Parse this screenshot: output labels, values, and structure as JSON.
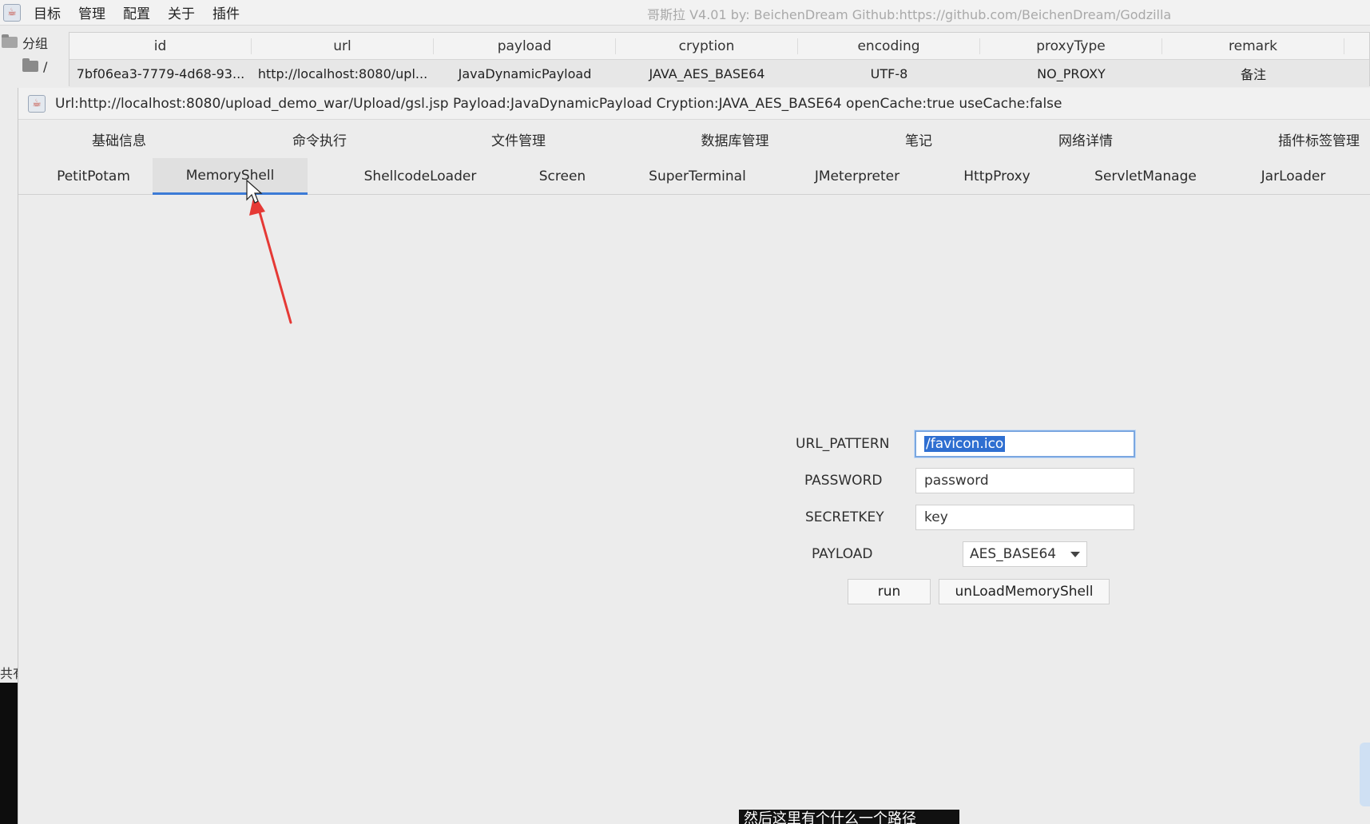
{
  "menubar": {
    "items": [
      "目标",
      "管理",
      "配置",
      "关于",
      "插件"
    ],
    "title": "哥斯拉   V4.01 by: BeichenDream Github:https://github.com/BeichenDream/Godzilla"
  },
  "tree": {
    "group_label": "分组",
    "root_label": "/"
  },
  "table": {
    "headers": [
      "id",
      "url",
      "payload",
      "cryption",
      "encoding",
      "proxyType",
      "remark"
    ],
    "row": [
      "7bf06ea3-7779-4d68-93...",
      "http://localhost:8080/upl...",
      "JavaDynamicPayload",
      "JAVA_AES_BASE64",
      "UTF-8",
      "NO_PROXY",
      "备注"
    ]
  },
  "shell": {
    "title": "Url:http://localhost:8080/upload_demo_war/Upload/gsl.jsp Payload:JavaDynamicPayload Cryption:JAVA_AES_BASE64 openCache:true useCache:false",
    "tabs_row1": [
      "基础信息",
      "命令执行",
      "文件管理",
      "数据库管理",
      "笔记",
      "网络详情",
      "插件标签管理"
    ],
    "tabs_row2": [
      "PetitPotam",
      "MemoryShell",
      "ShellcodeLoader",
      "Screen",
      "SuperTerminal",
      "JMeterpreter",
      "HttpProxy",
      "ServletManage",
      "JarLoader"
    ],
    "active_tab": "MemoryShell"
  },
  "form": {
    "url_pattern_label": "URL_PATTERN",
    "url_pattern_value": "/favicon.ico",
    "password_label": "PASSWORD",
    "password_value": "password",
    "secretkey_label": "SECRETKEY",
    "secretkey_value": "key",
    "payload_label": "PAYLOAD",
    "payload_value": "AES_BASE64",
    "run_label": "run",
    "unload_label": "unLoadMemoryShell"
  },
  "side_label": "共有",
  "subtitle": "然后这里有个什么一个路径",
  "colors": {
    "accent": "#3c7bd6",
    "selection": "#2f6fd1",
    "annotation_arrow": "#e53935"
  }
}
